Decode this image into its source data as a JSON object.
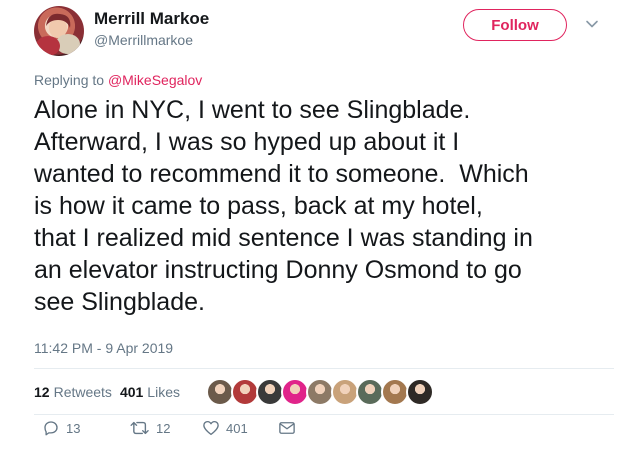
{
  "author": {
    "name": "Merrill Markoe",
    "handle": "@Merrillmarkoe"
  },
  "follow_label": "Follow",
  "reply": {
    "prefix": "Replying to ",
    "target": "@MikeSegalov"
  },
  "body": "Alone in NYC, I went to see Slingblade.\nAfterward, I was so hyped up about it I\nwanted to recommend it to someone.  Which\nis how it came to pass, back at my hotel,\nthat I realized mid sentence I was standing in\nan elevator instructing Donny Osmond to go\nsee Slingblade.",
  "timestamp": "11:42 PM - 9 Apr 2019",
  "stats": {
    "retweets_count": "12",
    "retweets_label": "Retweets",
    "likes_count": "401",
    "likes_label": "Likes"
  },
  "actions": {
    "replies": "13",
    "retweets": "12",
    "likes": "401"
  },
  "colors": {
    "accent": "#e0245e",
    "muted": "#657786",
    "text": "#14171a",
    "divider": "#e6ecf0"
  },
  "liker_avatars": [
    {
      "icon": "avatar-1",
      "color": "#6b5a4a"
    },
    {
      "icon": "avatar-2",
      "color": "#b23a3a"
    },
    {
      "icon": "avatar-3",
      "color": "#3a3a3a"
    },
    {
      "icon": "avatar-4",
      "color": "#e0248a"
    },
    {
      "icon": "avatar-5",
      "color": "#8d7a66"
    },
    {
      "icon": "avatar-6",
      "color": "#c9a27a"
    },
    {
      "icon": "avatar-7",
      "color": "#5a6b5a"
    },
    {
      "icon": "avatar-8",
      "color": "#a3784f"
    },
    {
      "icon": "avatar-9",
      "color": "#2f2a26"
    }
  ]
}
